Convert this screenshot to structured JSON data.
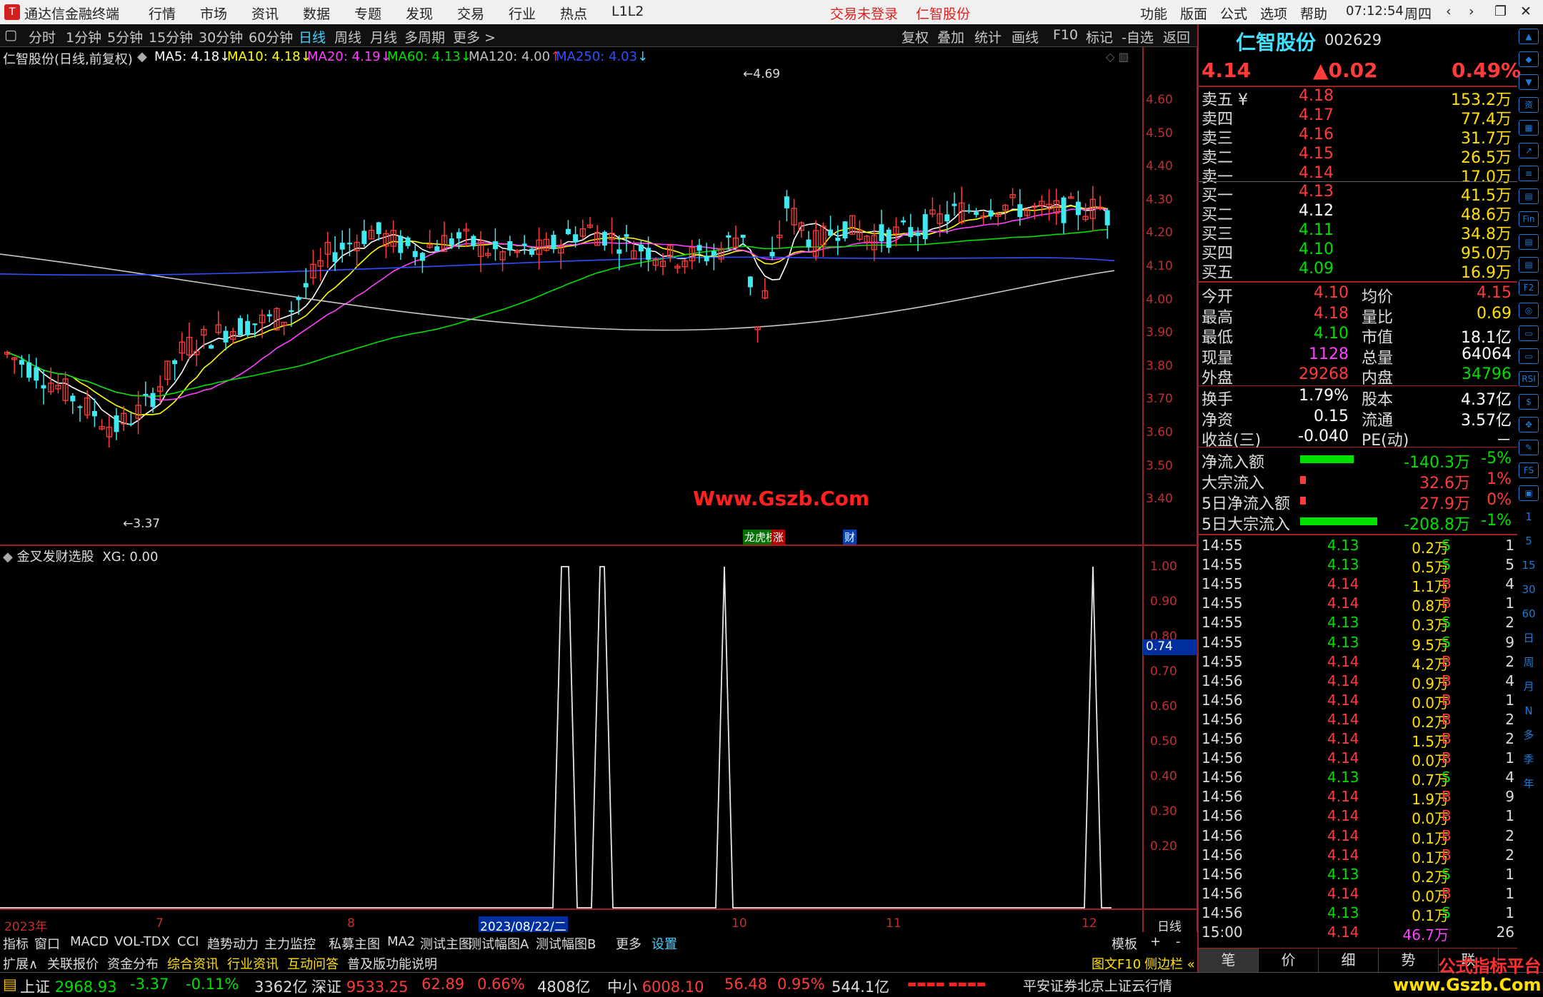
{
  "titlebar": {
    "app": "通达信金融终端",
    "menus": [
      "行情",
      "市场",
      "资讯",
      "数据",
      "专题",
      "发现",
      "交易",
      "行业",
      "热点",
      "L1L2"
    ],
    "login": "交易未登录",
    "stock": "仁智股份",
    "right_menus": [
      "功能",
      "版面",
      "公式",
      "选项",
      "帮助"
    ],
    "time": "07:12:54",
    "weekday": "周四"
  },
  "toolbar": {
    "periods": [
      "分时",
      "1分钟",
      "5分钟",
      "15分钟",
      "30分钟",
      "60分钟",
      "日线",
      "周线",
      "月线",
      "多周期",
      "更多 >"
    ],
    "active": "日线",
    "tools": [
      "复权",
      "叠加",
      "统计",
      "画线",
      "F10",
      "标记",
      "-自选",
      "返回"
    ]
  },
  "main_chart": {
    "title": "仁智股份(日线,前复权)",
    "ma": [
      {
        "label": "MA5: 4.18",
        "arrow": "↓",
        "color": "#ffffff"
      },
      {
        "label": "MA10: 4.18",
        "arrow": "↓",
        "color": "#ffff00"
      },
      {
        "label": "MA20: 4.19",
        "arrow": "↓",
        "color": "#ff40ff"
      },
      {
        "label": "MA60: 4.13",
        "arrow": "↓",
        "color": "#00e000"
      },
      {
        "label": "MA120: 4.00",
        "arrow": "↑",
        "color": "#c0c0c0"
      },
      {
        "label": "MA250: 4.03",
        "arrow": "↓",
        "color": "#3050ff"
      }
    ],
    "ylabels": [
      "4.60",
      "4.50",
      "4.40",
      "4.30",
      "4.20",
      "4.10",
      "4.00",
      "3.90",
      "3.80",
      "3.70",
      "3.60",
      "3.50",
      "3.40"
    ],
    "high_label": "4.69",
    "low_label": "3.37",
    "watermark": "Www.Gszb.Com",
    "badges": [
      "龙虎榜",
      "涨",
      "财"
    ]
  },
  "sub_chart": {
    "title": "金叉发财选股",
    "value": "XG: 0.00",
    "ylabels": [
      "1.00",
      "0.90",
      "0.80",
      "0.70",
      "0.60",
      "0.50",
      "0.40",
      "0.30",
      "0.20"
    ],
    "cursor_value": "0.74"
  },
  "xaxis": {
    "labels": [
      "2023年",
      "7",
      "8",
      "2023/08/22/二",
      "10",
      "11",
      "12"
    ],
    "period": "日线"
  },
  "tabs1": [
    "指标",
    "窗口",
    "MACD",
    "VOL-TDX",
    "CCI",
    "趋势动力",
    "主力监控",
    "私募主图",
    "MA2",
    "测试主图",
    "测试幅图A",
    "测试幅图B",
    "更多",
    "设置"
  ],
  "tabs1_right": [
    "模板",
    "+",
    "-"
  ],
  "tabs2": [
    "扩展∧",
    "关联报价",
    "资金分布",
    "综合资讯",
    "行业资讯",
    "互动问答",
    "普及版功能说明"
  ],
  "tabs2_right": [
    "图文F10",
    "侧边栏 «"
  ],
  "quote": {
    "name": "仁智股份",
    "code": "002629",
    "price": "4.14",
    "change": "▲0.02",
    "pct": "0.49%",
    "sell": [
      {
        "label": "卖五",
        "price": "4.18",
        "vol": "153.2万"
      },
      {
        "label": "卖四",
        "price": "4.17",
        "vol": "77.4万"
      },
      {
        "label": "卖三",
        "price": "4.16",
        "vol": "31.7万"
      },
      {
        "label": "卖二",
        "price": "4.15",
        "vol": "26.5万"
      },
      {
        "label": "卖一",
        "price": "4.14",
        "vol": "17.0万"
      }
    ],
    "buy": [
      {
        "label": "买一",
        "price": "4.13",
        "vol": "41.5万"
      },
      {
        "label": "买二",
        "price": "4.12",
        "vol": "48.6万"
      },
      {
        "label": "买三",
        "price": "4.11",
        "vol": "34.8万"
      },
      {
        "label": "买四",
        "price": "4.10",
        "vol": "95.0万"
      },
      {
        "label": "买五",
        "price": "4.09",
        "vol": "16.9万"
      }
    ],
    "stats": [
      {
        "l1": "今开",
        "v1": "4.10",
        "l2": "均价",
        "v2": "4.15"
      },
      {
        "l1": "最高",
        "v1": "4.18",
        "l2": "量比",
        "v2": "0.69"
      },
      {
        "l1": "最低",
        "v1": "4.10",
        "l2": "市值",
        "v2": "18.1亿"
      },
      {
        "l1": "现量",
        "v1": "1128",
        "l2": "总量",
        "v2": "64064"
      },
      {
        "l1": "外盘",
        "v1": "29268",
        "l2": "内盘",
        "v2": "34796"
      }
    ],
    "stats2": [
      {
        "l1": "换手",
        "v1": "1.79%",
        "l2": "股本",
        "v2": "4.37亿"
      },
      {
        "l1": "净资",
        "v1": "0.15",
        "l2": "流通",
        "v2": "3.57亿"
      },
      {
        "l1": "收益(三)",
        "v1": "-0.040",
        "l2": "PE(动)",
        "v2": "－"
      }
    ],
    "flows": [
      {
        "label": "净流入额",
        "value": "-140.3万",
        "pct": "-5%",
        "bar": 0.5
      },
      {
        "label": "大宗流入",
        "value": "32.6万",
        "pct": "1%",
        "bar": 0.05
      },
      {
        "label": "5日净流入额",
        "value": "27.9万",
        "pct": "0%",
        "bar": 0.05
      },
      {
        "label": "5日大宗流入",
        "value": "-208.8万",
        "pct": "-1%",
        "bar": 0.72
      }
    ]
  },
  "ticks": [
    [
      "14:55",
      "4.13",
      "0.2万",
      "S",
      "1"
    ],
    [
      "14:55",
      "4.13",
      "0.5万",
      "S",
      "5"
    ],
    [
      "14:55",
      "4.14",
      "1.1万",
      "B",
      "4"
    ],
    [
      "14:55",
      "4.14",
      "0.8万",
      "B",
      "1"
    ],
    [
      "14:55",
      "4.13",
      "0.3万",
      "S",
      "2"
    ],
    [
      "14:55",
      "4.13",
      "9.5万",
      "S",
      "9"
    ],
    [
      "14:55",
      "4.14",
      "4.2万",
      "B",
      "2"
    ],
    [
      "14:56",
      "4.14",
      "0.9万",
      "B",
      "4"
    ],
    [
      "14:56",
      "4.14",
      "0.0万",
      "B",
      "1"
    ],
    [
      "14:56",
      "4.14",
      "0.2万",
      "B",
      "2"
    ],
    [
      "14:56",
      "4.14",
      "1.5万",
      "B",
      "2"
    ],
    [
      "14:56",
      "4.14",
      "0.0万",
      "B",
      "1"
    ],
    [
      "14:56",
      "4.13",
      "0.7万",
      "S",
      "4"
    ],
    [
      "14:56",
      "4.14",
      "1.9万",
      "B",
      "9"
    ],
    [
      "14:56",
      "4.14",
      "0.0万",
      "B",
      "1"
    ],
    [
      "14:56",
      "4.14",
      "0.1万",
      "B",
      "2"
    ],
    [
      "14:56",
      "4.14",
      "0.1万",
      "B",
      "2"
    ],
    [
      "14:56",
      "4.13",
      "0.2万",
      "S",
      "1"
    ],
    [
      "14:56",
      "4.14",
      "0.0万",
      "B",
      "1"
    ],
    [
      "14:56",
      "4.13",
      "0.1万",
      "S",
      "1"
    ],
    [
      "15:00",
      "4.14",
      "46.7万",
      "",
      "26"
    ]
  ],
  "bottom_tabs": [
    "笔",
    "价",
    "细",
    "势",
    "联"
  ],
  "statusbar": {
    "indices": [
      {
        "name": "上证",
        "value": "2968.93",
        "chg": "-3.37",
        "pct": "-0.11%",
        "amt": "3362亿",
        "up": false
      },
      {
        "name": "深证",
        "value": "9533.25",
        "chg": "62.89",
        "pct": "0.66%",
        "amt": "4808亿",
        "up": true
      },
      {
        "name": "中小",
        "value": "6008.10",
        "chg": "56.48",
        "pct": "0.95%",
        "amt": "544.1亿",
        "up": true
      }
    ],
    "broker": "平安证券北京上证云行情",
    "watermark": "公式指标平台",
    "watermark_url": "www.Gszb.Com"
  },
  "side_icons": [
    "▲",
    "◆",
    "▼",
    "资",
    "▦",
    "↗",
    "≡",
    "▤",
    "Fin",
    "▤",
    "▤",
    "F2",
    "◎",
    "▭",
    "▭",
    "RSI",
    "$",
    "✥",
    "✎",
    "FS",
    "▣",
    "1",
    "5",
    "15",
    "30",
    "60",
    "日",
    "周",
    "月",
    "N",
    "多",
    "季",
    "年"
  ]
}
